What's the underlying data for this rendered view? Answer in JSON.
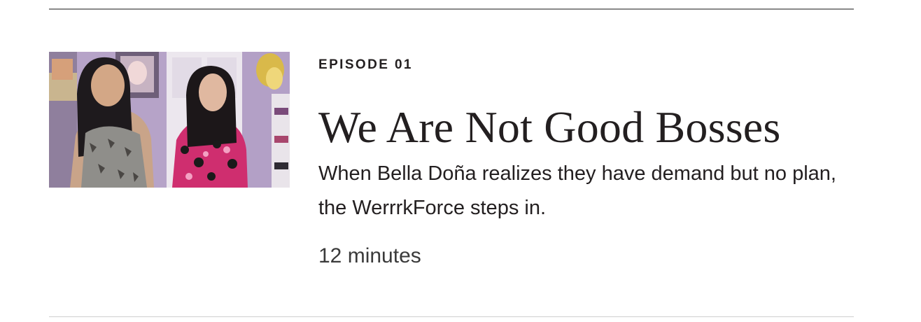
{
  "episode": {
    "label": "EPISODE 01",
    "title": "We Are Not Good Bosses",
    "description": "When Bella Doña realizes they have demand but no plan, the WerrrkForce steps in.",
    "duration": "12 minutes",
    "thumbnail_alt": "Two women smiling in a lavender room"
  },
  "colors": {
    "text": "#231f20",
    "rule": "#8a8a8a",
    "wall": "#b8a6c9"
  }
}
